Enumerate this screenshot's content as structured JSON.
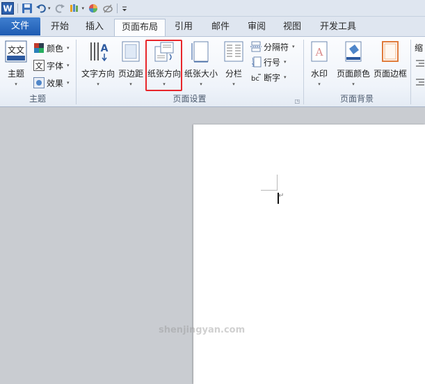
{
  "quick_access": {
    "app_icon_letter": "W",
    "icons": [
      "save-icon",
      "undo-icon",
      "redo-icon",
      "format-painter-icon",
      "color-icon",
      "clear-format-icon",
      "customize-icon"
    ]
  },
  "tabs": [
    {
      "label": "文件"
    },
    {
      "label": "开始"
    },
    {
      "label": "插入"
    },
    {
      "label": "页面布局"
    },
    {
      "label": "引用"
    },
    {
      "label": "邮件"
    },
    {
      "label": "审阅"
    },
    {
      "label": "视图"
    },
    {
      "label": "开发工具"
    }
  ],
  "ribbon": {
    "theme_group": {
      "label": "主题",
      "theme_button": "主题",
      "theme_icon_text": "文文",
      "colors": "颜色",
      "fonts": "字体",
      "font_icon_text": "文",
      "effects": "效果"
    },
    "page_setup_group": {
      "label": "页面设置",
      "text_direction": "文字方向",
      "margins": "页边距",
      "orientation": "纸张方向",
      "size": "纸张大小",
      "columns": "分栏",
      "breaks": "分隔符",
      "line_numbers": "行号",
      "hyphenation": "断字",
      "hyphen_icon_text": "bc"
    },
    "page_background_group": {
      "label": "页面背景",
      "watermark": "水印",
      "watermark_icon_text": "A",
      "page_color": "页面颜色",
      "page_borders": "页面边框"
    },
    "paragraph_group_partial": {
      "indent": "缩"
    }
  },
  "document": {
    "paragraph_mark": "↵"
  },
  "watermark_text": "shenjingyan.com",
  "colors": {
    "file_tab": "#2b6cc4",
    "highlight_box": "#e8262b"
  }
}
